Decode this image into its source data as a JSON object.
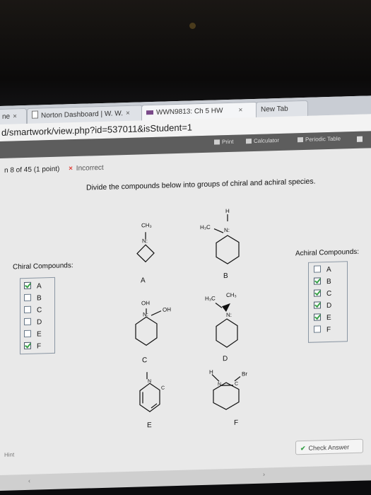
{
  "browser": {
    "tabs": [
      {
        "label": "ne",
        "close": "×"
      },
      {
        "label": "Norton Dashboard | W. W.",
        "close": "×"
      },
      {
        "label": "WWN9813: Ch 5 HW",
        "close": "×"
      },
      {
        "label": "New Tab"
      }
    ],
    "url": "d/smartwork/view.php?id=537011&isStudent=1"
  },
  "toolbar": {
    "print": "Print",
    "calculator": "Calculator",
    "periodic_table": "Periodic Table"
  },
  "question": {
    "header": "n 8 of 45 (1 point)",
    "status_icon": "×",
    "status": "Incorrect",
    "prompt": "Divide the compounds below into groups of chiral and achiral species."
  },
  "chiral": {
    "title": "Chiral Compounds:",
    "items": [
      {
        "label": "A",
        "checked": true
      },
      {
        "label": "B",
        "checked": false
      },
      {
        "label": "C",
        "checked": false
      },
      {
        "label": "D",
        "checked": false
      },
      {
        "label": "E",
        "checked": false
      },
      {
        "label": "F",
        "checked": true
      }
    ]
  },
  "achiral": {
    "title": "Achiral Compounds:",
    "items": [
      {
        "label": "A",
        "checked": false
      },
      {
        "label": "B",
        "checked": true
      },
      {
        "label": "C",
        "checked": true
      },
      {
        "label": "D",
        "checked": true
      },
      {
        "label": "E",
        "checked": true
      },
      {
        "label": "F",
        "checked": false
      }
    ]
  },
  "molecules": {
    "A": {
      "label": "A",
      "substituent": "CH₃",
      "atom": "N:"
    },
    "B": {
      "label": "B",
      "h": "H",
      "substituent": "H₃C",
      "atom": "N:"
    },
    "C": {
      "label": "C",
      "top": "OH",
      "atom": "N:",
      "side": "OH"
    },
    "D": {
      "label": "D",
      "left": "H₃C",
      "right": "CH₃",
      "atom": "N:"
    },
    "E": {
      "label": "E",
      "atom1": "N",
      "atom2": "C"
    },
    "F": {
      "label": "F",
      "h": "H",
      "br": "Br",
      "atom1": "N",
      "atom2": "C"
    }
  },
  "footer": {
    "hint": "Hint",
    "check_answer": "Check Answer"
  }
}
